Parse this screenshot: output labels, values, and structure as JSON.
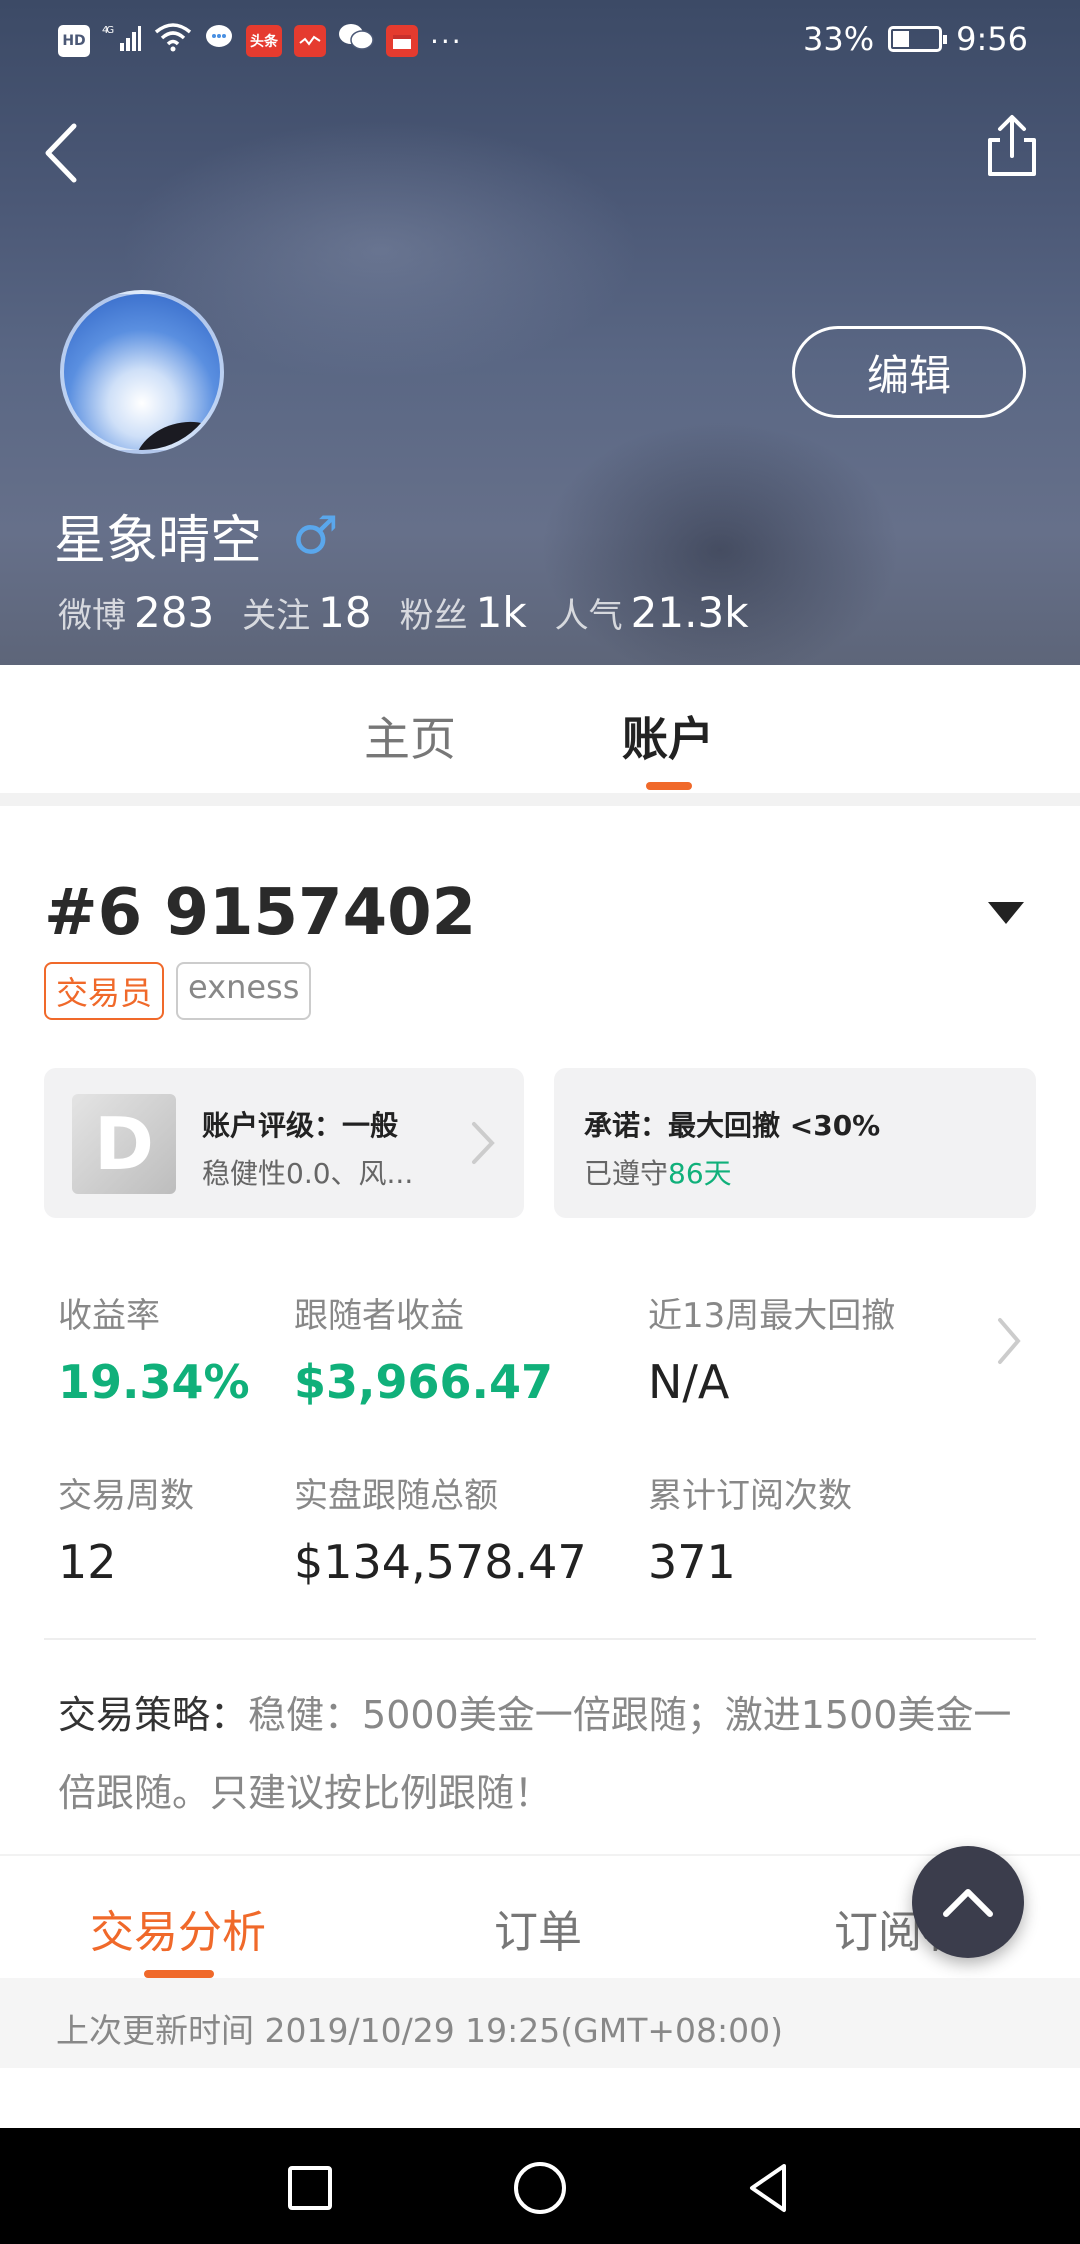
{
  "status_bar": {
    "left_icons": [
      "hd-icon",
      "4g-signal-icon",
      "wifi-icon",
      "chat-bubble-icon",
      "toutiao-icon",
      "app-red-icon",
      "wechat-icon",
      "calendar-icon",
      "more-dots-icon"
    ],
    "battery": "33%",
    "time": "9:56",
    "hd_label": "HD",
    "toutiao_label": "头条",
    "dots": "···"
  },
  "header": {
    "edit_label": "编辑",
    "username": "星象晴空",
    "gender_symbol": "♂",
    "stats": [
      {
        "label": "微博",
        "value": "283"
      },
      {
        "label": "关注",
        "value": "18"
      },
      {
        "label": "粉丝",
        "value": "1k"
      },
      {
        "label": "人气",
        "value": "21.3k"
      }
    ]
  },
  "tabs": [
    {
      "label": "主页",
      "active": false
    },
    {
      "label": "账户",
      "active": true
    }
  ],
  "account": {
    "number": "#6 9157402",
    "tags": [
      "交易员",
      "exness"
    ],
    "rating": {
      "grade": "D",
      "title": "账户评级：一般",
      "subtitle": "稳健性0.0、风..."
    },
    "promise": {
      "title": "承诺：最大回撤 <30%",
      "kept_prefix": "已遵守",
      "kept_days": "86天"
    },
    "metrics": [
      {
        "label": "收益率",
        "value": "19.34%",
        "highlight": true
      },
      {
        "label": "跟随者收益",
        "value": "$3,966.47",
        "highlight": true
      },
      {
        "label": "近13周最大回撤",
        "value": "N/A",
        "highlight": false
      },
      {
        "label": "交易周数",
        "value": "12",
        "highlight": false
      },
      {
        "label": "实盘跟随总额",
        "value": "$134,578.47",
        "highlight": false
      },
      {
        "label": "累计订阅次数",
        "value": "371",
        "highlight": false
      }
    ],
    "strategy_label": "交易策略：",
    "strategy_text": "稳健：5000美金一倍跟随；激进1500美金一倍跟随。只建议按比例跟随！"
  },
  "bottom_tabs": [
    {
      "label": "交易分析",
      "active": true
    },
    {
      "label": "订单",
      "active": false
    },
    {
      "label": "订阅者",
      "active": false
    }
  ],
  "update_time": "上次更新时间 2019/10/29 19:25(GMT+08:00)",
  "colors": {
    "accent": "#f0692a",
    "positive": "#10b07a",
    "gender": "#5aa7ec"
  }
}
